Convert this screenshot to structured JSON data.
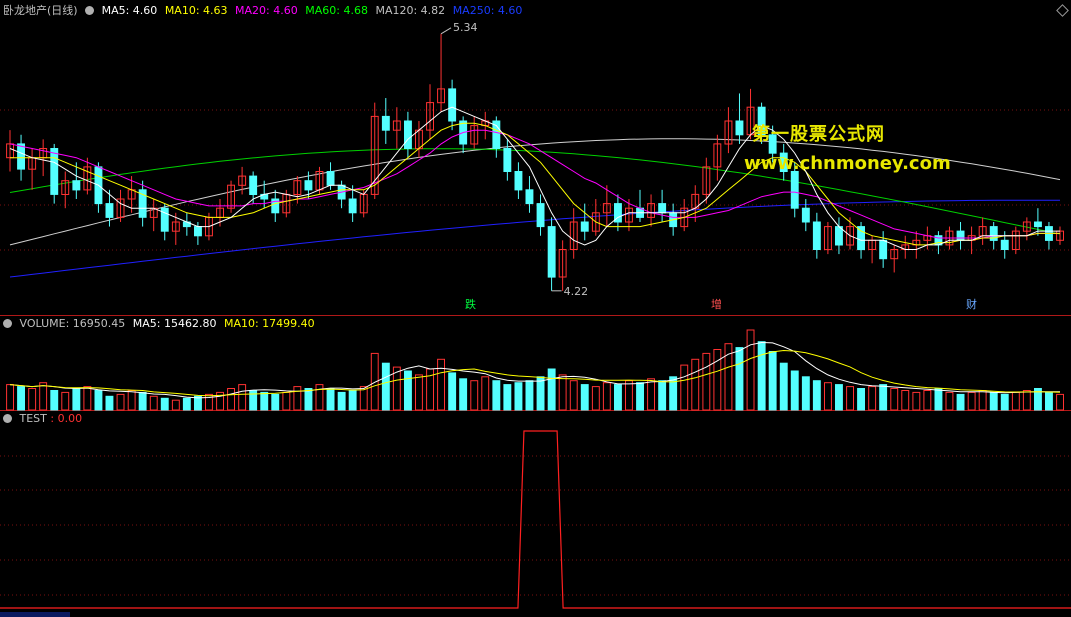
{
  "main": {
    "title": "卧龙地产(日线)",
    "ma5": "MA5: 4.60",
    "ma10": "MA10: 4.63",
    "ma20": "MA20: 4.60",
    "ma60": "MA60: 4.68",
    "ma120": "MA120: 4.82",
    "ma250": "MA250: 4.60",
    "high_label": "5.34",
    "low_label": "4.22",
    "tag_die": "跌",
    "tag_zeng": "增",
    "tag_cai": "财",
    "watermark_title": "第一股票公式网",
    "watermark_url": "www.chnmoney.com",
    "colors": {
      "ma5": "#ffffff",
      "ma10": "#ffff00",
      "ma20": "#ff00ff",
      "ma60": "#00ff00",
      "ma120": "#c0c0c0",
      "ma250": "#0000ff",
      "up": "#ff3232",
      "down": "#54ffff"
    }
  },
  "volume": {
    "title": "VOLUME: 16950.45",
    "ma5": "MA5: 15462.80",
    "ma10": "MA10: 17499.40"
  },
  "test": {
    "title": "TEST",
    "value": ": 0.00"
  },
  "chart_data": {
    "type": "candlestick",
    "ohlc": [
      [
        4.8,
        4.92,
        4.74,
        4.86
      ],
      [
        4.86,
        4.9,
        4.7,
        4.75
      ],
      [
        4.75,
        4.84,
        4.66,
        4.8
      ],
      [
        4.8,
        4.88,
        4.72,
        4.84
      ],
      [
        4.84,
        4.86,
        4.6,
        4.64
      ],
      [
        4.64,
        4.74,
        4.58,
        4.7
      ],
      [
        4.7,
        4.78,
        4.62,
        4.66
      ],
      [
        4.66,
        4.8,
        4.64,
        4.76
      ],
      [
        4.76,
        4.78,
        4.56,
        4.6
      ],
      [
        4.6,
        4.66,
        4.5,
        4.54
      ],
      [
        4.54,
        4.66,
        4.52,
        4.62
      ],
      [
        4.62,
        4.72,
        4.56,
        4.66
      ],
      [
        4.66,
        4.7,
        4.5,
        4.54
      ],
      [
        4.54,
        4.62,
        4.48,
        4.58
      ],
      [
        4.58,
        4.6,
        4.44,
        4.48
      ],
      [
        4.48,
        4.56,
        4.42,
        4.52
      ],
      [
        4.52,
        4.56,
        4.46,
        4.5
      ],
      [
        4.5,
        4.52,
        4.42,
        4.46
      ],
      [
        4.46,
        4.56,
        4.44,
        4.54
      ],
      [
        4.54,
        4.62,
        4.5,
        4.58
      ],
      [
        4.58,
        4.7,
        4.56,
        4.68
      ],
      [
        4.68,
        4.76,
        4.64,
        4.72
      ],
      [
        4.72,
        4.74,
        4.6,
        4.64
      ],
      [
        4.64,
        4.7,
        4.58,
        4.62
      ],
      [
        4.62,
        4.66,
        4.52,
        4.56
      ],
      [
        4.56,
        4.66,
        4.54,
        4.64
      ],
      [
        4.64,
        4.72,
        4.6,
        4.7
      ],
      [
        4.7,
        4.74,
        4.62,
        4.66
      ],
      [
        4.66,
        4.76,
        4.64,
        4.74
      ],
      [
        4.74,
        4.78,
        4.66,
        4.68
      ],
      [
        4.68,
        4.7,
        4.58,
        4.62
      ],
      [
        4.62,
        4.68,
        4.52,
        4.56
      ],
      [
        4.56,
        4.66,
        4.54,
        4.64
      ],
      [
        4.64,
        5.04,
        4.62,
        4.98
      ],
      [
        4.98,
        5.06,
        4.86,
        4.92
      ],
      [
        4.92,
        5.02,
        4.84,
        4.96
      ],
      [
        4.96,
        5.0,
        4.8,
        4.84
      ],
      [
        4.84,
        4.96,
        4.8,
        4.92
      ],
      [
        4.92,
        5.12,
        4.88,
        5.04
      ],
      [
        5.04,
        5.34,
        5.0,
        5.1
      ],
      [
        5.1,
        5.14,
        4.92,
        4.96
      ],
      [
        4.96,
        4.98,
        4.82,
        4.86
      ],
      [
        4.86,
        4.98,
        4.84,
        4.94
      ],
      [
        4.94,
        5.0,
        4.88,
        4.96
      ],
      [
        4.96,
        4.98,
        4.8,
        4.84
      ],
      [
        4.84,
        4.88,
        4.7,
        4.74
      ],
      [
        4.74,
        4.78,
        4.62,
        4.66
      ],
      [
        4.66,
        4.72,
        4.56,
        4.6
      ],
      [
        4.6,
        4.64,
        4.46,
        4.5
      ],
      [
        4.5,
        4.54,
        4.22,
        4.28
      ],
      [
        4.28,
        4.44,
        4.22,
        4.4
      ],
      [
        4.4,
        4.58,
        4.36,
        4.52
      ],
      [
        4.52,
        4.6,
        4.44,
        4.48
      ],
      [
        4.48,
        4.62,
        4.46,
        4.56
      ],
      [
        4.56,
        4.68,
        4.5,
        4.6
      ],
      [
        4.6,
        4.64,
        4.48,
        4.52
      ],
      [
        4.52,
        4.62,
        4.48,
        4.58
      ],
      [
        4.58,
        4.66,
        4.52,
        4.54
      ],
      [
        4.54,
        4.64,
        4.5,
        4.6
      ],
      [
        4.6,
        4.66,
        4.52,
        4.56
      ],
      [
        4.56,
        4.6,
        4.46,
        4.5
      ],
      [
        4.5,
        4.62,
        4.48,
        4.58
      ],
      [
        4.58,
        4.68,
        4.52,
        4.64
      ],
      [
        4.64,
        4.8,
        4.6,
        4.76
      ],
      [
        4.76,
        4.9,
        4.7,
        4.86
      ],
      [
        4.86,
        5.02,
        4.82,
        4.96
      ],
      [
        4.96,
        5.08,
        4.86,
        4.9
      ],
      [
        4.9,
        5.1,
        4.88,
        5.02
      ],
      [
        5.02,
        5.04,
        4.86,
        4.9
      ],
      [
        4.9,
        4.94,
        4.78,
        4.82
      ],
      [
        4.82,
        4.86,
        4.7,
        4.74
      ],
      [
        4.74,
        4.78,
        4.54,
        4.58
      ],
      [
        4.58,
        4.62,
        4.48,
        4.52
      ],
      [
        4.52,
        4.56,
        4.36,
        4.4
      ],
      [
        4.4,
        4.52,
        4.38,
        4.5
      ],
      [
        4.5,
        4.54,
        4.38,
        4.42
      ],
      [
        4.42,
        4.54,
        4.4,
        4.5
      ],
      [
        4.5,
        4.52,
        4.36,
        4.4
      ],
      [
        4.4,
        4.46,
        4.34,
        4.44
      ],
      [
        4.44,
        4.48,
        4.32,
        4.36
      ],
      [
        4.36,
        4.42,
        4.3,
        4.4
      ],
      [
        4.4,
        4.46,
        4.36,
        4.42
      ],
      [
        4.42,
        4.48,
        4.36,
        4.44
      ],
      [
        4.44,
        4.5,
        4.4,
        4.46
      ],
      [
        4.46,
        4.48,
        4.38,
        4.42
      ],
      [
        4.42,
        4.5,
        4.4,
        4.48
      ],
      [
        4.48,
        4.52,
        4.4,
        4.44
      ],
      [
        4.44,
        4.5,
        4.38,
        4.46
      ],
      [
        4.46,
        4.54,
        4.42,
        4.5
      ],
      [
        4.5,
        4.52,
        4.4,
        4.44
      ],
      [
        4.44,
        4.48,
        4.36,
        4.4
      ],
      [
        4.4,
        4.5,
        4.38,
        4.48
      ],
      [
        4.48,
        4.54,
        4.44,
        4.52
      ],
      [
        4.52,
        4.58,
        4.46,
        4.5
      ],
      [
        4.5,
        4.52,
        4.4,
        4.44
      ],
      [
        4.44,
        4.5,
        4.42,
        4.48
      ]
    ],
    "volume_values": [
      26,
      24,
      22,
      28,
      20,
      18,
      22,
      24,
      20,
      14,
      16,
      20,
      18,
      14,
      12,
      10,
      12,
      14,
      16,
      18,
      22,
      26,
      20,
      18,
      16,
      18,
      24,
      22,
      26,
      22,
      18,
      20,
      24,
      58,
      48,
      44,
      40,
      36,
      42,
      52,
      38,
      32,
      30,
      34,
      30,
      26,
      28,
      30,
      34,
      42,
      36,
      30,
      26,
      24,
      28,
      26,
      30,
      28,
      32,
      30,
      34,
      46,
      52,
      58,
      62,
      68,
      64,
      82,
      70,
      60,
      48,
      40,
      34,
      30,
      28,
      26,
      24,
      22,
      24,
      26,
      22,
      20,
      18,
      20,
      22,
      18,
      16,
      18,
      20,
      18,
      16,
      18,
      20,
      22,
      18,
      16
    ],
    "ma_lines": {
      "ma5": [
        4.84,
        4.82,
        4.8,
        4.79,
        4.78,
        4.75,
        4.72,
        4.7,
        4.68,
        4.64,
        4.6,
        4.58,
        4.58,
        4.58,
        4.56,
        4.54,
        4.52,
        4.5,
        4.5,
        4.52,
        4.54,
        4.58,
        4.62,
        4.64,
        4.65,
        4.64,
        4.63,
        4.64,
        4.66,
        4.68,
        4.68,
        4.66,
        4.64,
        4.7,
        4.76,
        4.82,
        4.88,
        4.92,
        4.96,
        5.0,
        5.02,
        5.0,
        4.98,
        4.96,
        4.94,
        4.88,
        4.82,
        4.76,
        4.66,
        4.56,
        4.48,
        4.44,
        4.42,
        4.44,
        4.5,
        4.54,
        4.56,
        4.56,
        4.56,
        4.56,
        4.56,
        4.56,
        4.58,
        4.62,
        4.68,
        4.76,
        4.84,
        4.9,
        4.94,
        4.92,
        4.88,
        4.82,
        4.74,
        4.64,
        4.56,
        4.5,
        4.46,
        4.44,
        4.44,
        4.44,
        4.42,
        4.4,
        4.4,
        4.42,
        4.42,
        4.44,
        4.44,
        4.44,
        4.46,
        4.46,
        4.46,
        4.46,
        4.46,
        4.48,
        4.48,
        4.48
      ],
      "ma10": [
        4.8,
        4.8,
        4.8,
        4.8,
        4.8,
        4.78,
        4.76,
        4.74,
        4.72,
        4.7,
        4.68,
        4.66,
        4.64,
        4.62,
        4.6,
        4.58,
        4.56,
        4.55,
        4.54,
        4.54,
        4.54,
        4.55,
        4.56,
        4.58,
        4.6,
        4.61,
        4.62,
        4.63,
        4.64,
        4.65,
        4.66,
        4.66,
        4.66,
        4.68,
        4.72,
        4.76,
        4.8,
        4.84,
        4.88,
        4.92,
        4.94,
        4.95,
        4.95,
        4.94,
        4.92,
        4.9,
        4.86,
        4.82,
        4.78,
        4.72,
        4.66,
        4.6,
        4.56,
        4.52,
        4.5,
        4.5,
        4.5,
        4.5,
        4.51,
        4.52,
        4.53,
        4.54,
        4.56,
        4.58,
        4.62,
        4.66,
        4.7,
        4.74,
        4.78,
        4.8,
        4.8,
        4.78,
        4.74,
        4.68,
        4.62,
        4.56,
        4.52,
        4.48,
        4.46,
        4.45,
        4.44,
        4.43,
        4.42,
        4.42,
        4.43,
        4.43,
        4.44,
        4.44,
        4.45,
        4.45,
        4.46,
        4.46,
        4.46,
        4.47,
        4.47,
        4.47
      ],
      "ma20": [
        4.86,
        4.85,
        4.84,
        4.83,
        4.82,
        4.81,
        4.8,
        4.78,
        4.76,
        4.74,
        4.72,
        4.7,
        4.68,
        4.66,
        4.64,
        4.62,
        4.61,
        4.6,
        4.59,
        4.59,
        4.59,
        4.59,
        4.6,
        4.6,
        4.61,
        4.61,
        4.62,
        4.62,
        4.63,
        4.64,
        4.65,
        4.66,
        4.67,
        4.69,
        4.71,
        4.73,
        4.76,
        4.79,
        4.82,
        4.86,
        4.89,
        4.91,
        4.92,
        4.92,
        4.91,
        4.9,
        4.88,
        4.86,
        4.83,
        4.8,
        4.77,
        4.74,
        4.71,
        4.69,
        4.66,
        4.63,
        4.6,
        4.58,
        4.56,
        4.55,
        4.54,
        4.54,
        4.54,
        4.55,
        4.56,
        4.57,
        4.59,
        4.61,
        4.63,
        4.64,
        4.65,
        4.65,
        4.64,
        4.63,
        4.61,
        4.59,
        4.57,
        4.55,
        4.53,
        4.51,
        4.49,
        4.48,
        4.47,
        4.46,
        4.45,
        4.45,
        4.45,
        4.45,
        4.45,
        4.46,
        4.46,
        4.46,
        4.46,
        4.47,
        4.47,
        4.47
      ]
    }
  }
}
